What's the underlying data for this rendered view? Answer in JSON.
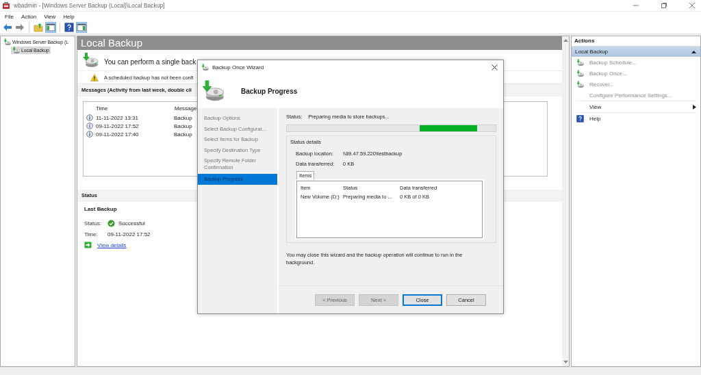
{
  "window": {
    "title": "wbadmin - [Windows Server Backup (Local)\\Local Backup]"
  },
  "menu": [
    "File",
    "Action",
    "View",
    "Help"
  ],
  "toolbar": [
    {
      "kind": "back",
      "on": false
    },
    {
      "kind": "forward",
      "on": false
    },
    {
      "kind": "separator"
    },
    {
      "kind": "up",
      "on": false
    },
    {
      "kind": "tree",
      "on": true
    },
    {
      "kind": "separator"
    },
    {
      "kind": "help",
      "on": false
    },
    {
      "kind": "pane",
      "on": true
    }
  ],
  "tree": [
    {
      "label": "Windows Server Backup (L",
      "selected": false,
      "children": [
        {
          "label": "Local Backup",
          "selected": true
        }
      ]
    }
  ],
  "main": {
    "title": "Local Backup",
    "intro": "You can perform a single back",
    "warning": "A scheduled backup has not been confi",
    "messages": {
      "heading": "Messages (Activity from last week, double cli",
      "columns": [
        "Time",
        "Message"
      ],
      "rows": [
        {
          "time": "11-11-2022 13:31",
          "message": "Backup"
        },
        {
          "time": "09-11-2022 17:52",
          "message": "Backup"
        },
        {
          "time": "09-11-2022 17:40",
          "message": "Backup"
        }
      ]
    },
    "status": {
      "heading": "Status",
      "subheading": "Last Backup",
      "fields": [
        {
          "label": "Status:",
          "value": "Successful",
          "kind": "success"
        },
        {
          "label": "Time:",
          "value": "09-11-2022 17:52",
          "kind": "plain"
        }
      ],
      "link": "View details"
    }
  },
  "actions": {
    "title": "Actions",
    "section": "Local Backup",
    "items": [
      {
        "label": "Backup Schedule...",
        "kind": "schedule",
        "disabled": true
      },
      {
        "label": "Backup Once...",
        "kind": "once",
        "disabled": true
      },
      {
        "label": "Recover...",
        "kind": "recover",
        "disabled": true
      },
      {
        "label": "Configure Performance Settings...",
        "kind": "plain",
        "disabled": true
      },
      {
        "label": "View",
        "kind": "submenu",
        "disabled": false
      },
      {
        "label": "Help",
        "kind": "help",
        "disabled": false
      }
    ]
  },
  "dialog": {
    "title": "Backup Once Wizard",
    "heading": "Backup Progress",
    "steps": [
      {
        "label": "Backup Options",
        "selected": false
      },
      {
        "label": "Select Backup Configurat...",
        "selected": false
      },
      {
        "label": "Select Items for Backup",
        "selected": false
      },
      {
        "label": "Specify Destination Type",
        "selected": false
      },
      {
        "label": "Specify Remote Folder Confirmation",
        "selected": false
      },
      {
        "label": "Backup Progress",
        "selected": true
      }
    ],
    "status_label": "Status:",
    "status_text": "Preparing media to store backups...",
    "group": "Status details",
    "details": [
      {
        "label": "Backup location:",
        "value": "\\\\89.47.59.220\\testbackup"
      },
      {
        "label": "Data transferred:",
        "value": "0 KB"
      }
    ],
    "items_tab": "Items",
    "table": {
      "columns": [
        "Item",
        "Status",
        "Data transferred"
      ],
      "rows": [
        [
          "New Volume (D:)",
          "Preparing media to ...",
          "0 KB of 0 KB"
        ]
      ]
    },
    "note": "You may close this wizard and the backup operation will continue to run in the background.",
    "buttons": [
      {
        "label": "< Previous",
        "disabled": true,
        "default": false
      },
      {
        "label": "Next >",
        "disabled": true,
        "default": false
      },
      {
        "label": "Close",
        "disabled": false,
        "default": true
      },
      {
        "label": "Cancel",
        "disabled": false,
        "default": false
      }
    ]
  }
}
